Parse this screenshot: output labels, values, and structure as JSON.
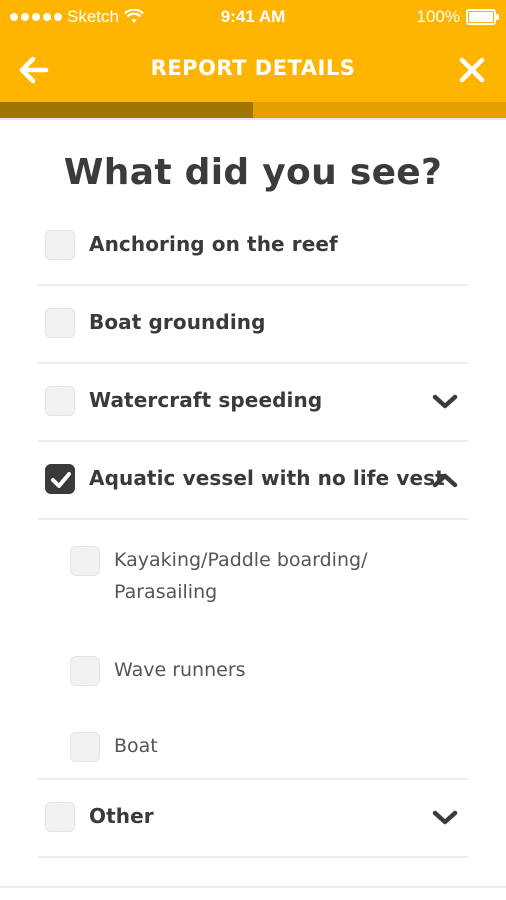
{
  "status_bar": {
    "carrier": "Sketch",
    "time": "9:41 AM",
    "battery": "100%"
  },
  "nav": {
    "title": "REPORT DETAILS",
    "back_icon": "arrow-left-icon",
    "close_icon": "close-icon"
  },
  "progress": {
    "fraction": 0.5
  },
  "colors": {
    "accent": "#FFB400",
    "progress_fill": "#9E7600",
    "text": "#3a3a3a"
  },
  "page": {
    "title": "What did you see?"
  },
  "items": [
    {
      "label": "Anchoring on the reef",
      "checked": false,
      "chevron": "none"
    },
    {
      "label": "Boat grounding",
      "checked": false,
      "chevron": "none"
    },
    {
      "label": "Watercraft speeding",
      "checked": false,
      "chevron": "chevron-down-icon"
    },
    {
      "label": "Aquatic vessel with no life vest",
      "checked": true,
      "chevron": "chevron-up-icon",
      "subitems": [
        {
          "label_line1": "Kayaking/Paddle boarding/",
          "label_line2": "Parasailing",
          "checked": false
        },
        {
          "label": "Wave runners",
          "checked": false
        },
        {
          "label": "Boat",
          "checked": false
        }
      ]
    },
    {
      "label": "Other",
      "checked": false,
      "chevron": "chevron-down-icon"
    }
  ]
}
